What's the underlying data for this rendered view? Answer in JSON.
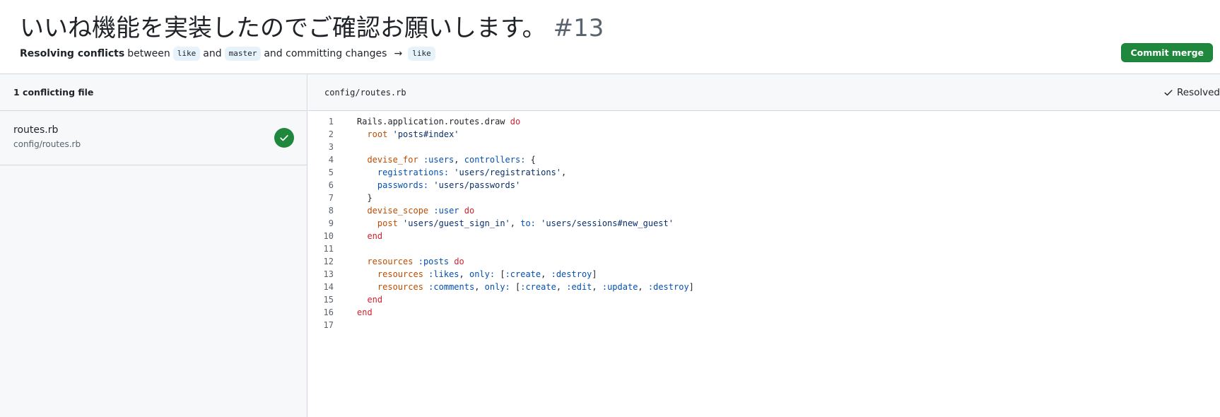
{
  "header": {
    "title": "いいね機能を実装したのでご確認お願いします。",
    "number": "#13",
    "subtitle_strong": "Resolving conflicts",
    "subtitle_between": "between",
    "branch_head": "like",
    "subtitle_and": "and",
    "branch_base": "master",
    "subtitle_committing": "and committing changes",
    "arrow": "→",
    "branch_target": "like",
    "commit_button": "Commit merge"
  },
  "sidebar": {
    "heading": "1 conflicting file",
    "files": [
      {
        "name": "routes.rb",
        "path": "config/routes.rb",
        "status_icon": "check-circle-icon"
      }
    ]
  },
  "editor": {
    "file_path": "config/routes.rb",
    "resolved_label": "Resolved",
    "lines": [
      {
        "n": "1",
        "tokens": [
          [
            "p",
            "Rails.application.routes.draw "
          ],
          [
            "kw",
            "do"
          ]
        ]
      },
      {
        "n": "2",
        "tokens": [
          [
            "p",
            "  "
          ],
          [
            "fn",
            "root"
          ],
          [
            "p",
            " "
          ],
          [
            "str",
            "'posts#index'"
          ]
        ]
      },
      {
        "n": "3",
        "tokens": [
          [
            "p",
            ""
          ]
        ]
      },
      {
        "n": "4",
        "tokens": [
          [
            "p",
            "  "
          ],
          [
            "fn",
            "devise_for"
          ],
          [
            "p",
            " "
          ],
          [
            "sym",
            ":users"
          ],
          [
            "p",
            ", "
          ],
          [
            "sym",
            "controllers:"
          ],
          [
            "p",
            " {"
          ]
        ]
      },
      {
        "n": "5",
        "tokens": [
          [
            "p",
            "    "
          ],
          [
            "sym",
            "registrations:"
          ],
          [
            "p",
            " "
          ],
          [
            "str",
            "'users/registrations'"
          ],
          [
            "p",
            ","
          ]
        ]
      },
      {
        "n": "6",
        "tokens": [
          [
            "p",
            "    "
          ],
          [
            "sym",
            "passwords:"
          ],
          [
            "p",
            " "
          ],
          [
            "str",
            "'users/passwords'"
          ]
        ]
      },
      {
        "n": "7",
        "tokens": [
          [
            "p",
            "  }"
          ]
        ]
      },
      {
        "n": "8",
        "tokens": [
          [
            "p",
            "  "
          ],
          [
            "fn",
            "devise_scope"
          ],
          [
            "p",
            " "
          ],
          [
            "sym",
            ":user"
          ],
          [
            "p",
            " "
          ],
          [
            "kw",
            "do"
          ]
        ]
      },
      {
        "n": "9",
        "tokens": [
          [
            "p",
            "    "
          ],
          [
            "fn",
            "post"
          ],
          [
            "p",
            " "
          ],
          [
            "str",
            "'users/guest_sign_in'"
          ],
          [
            "p",
            ", "
          ],
          [
            "sym",
            "to:"
          ],
          [
            "p",
            " "
          ],
          [
            "str",
            "'users/sessions#new_guest'"
          ]
        ]
      },
      {
        "n": "10",
        "tokens": [
          [
            "p",
            "  "
          ],
          [
            "kw",
            "end"
          ]
        ]
      },
      {
        "n": "11",
        "tokens": [
          [
            "p",
            ""
          ]
        ]
      },
      {
        "n": "12",
        "tokens": [
          [
            "p",
            "  "
          ],
          [
            "fn",
            "resources"
          ],
          [
            "p",
            " "
          ],
          [
            "sym",
            ":posts"
          ],
          [
            "p",
            " "
          ],
          [
            "kw",
            "do"
          ]
        ]
      },
      {
        "n": "13",
        "tokens": [
          [
            "p",
            "    "
          ],
          [
            "fn",
            "resources"
          ],
          [
            "p",
            " "
          ],
          [
            "sym",
            ":likes"
          ],
          [
            "p",
            ", "
          ],
          [
            "sym",
            "only:"
          ],
          [
            "p",
            " ["
          ],
          [
            "sym",
            ":create"
          ],
          [
            "p",
            ", "
          ],
          [
            "sym",
            ":destroy"
          ],
          [
            "p",
            "]"
          ]
        ]
      },
      {
        "n": "14",
        "tokens": [
          [
            "p",
            "    "
          ],
          [
            "fn",
            "resources"
          ],
          [
            "p",
            " "
          ],
          [
            "sym",
            ":comments"
          ],
          [
            "p",
            ", "
          ],
          [
            "sym",
            "only:"
          ],
          [
            "p",
            " ["
          ],
          [
            "sym",
            ":create"
          ],
          [
            "p",
            ", "
          ],
          [
            "sym",
            ":edit"
          ],
          [
            "p",
            ", "
          ],
          [
            "sym",
            ":update"
          ],
          [
            "p",
            ", "
          ],
          [
            "sym",
            ":destroy"
          ],
          [
            "p",
            "]"
          ]
        ]
      },
      {
        "n": "15",
        "tokens": [
          [
            "p",
            "  "
          ],
          [
            "kw",
            "end"
          ]
        ]
      },
      {
        "n": "16",
        "tokens": [
          [
            "kw",
            "end"
          ]
        ]
      },
      {
        "n": "17",
        "tokens": [
          [
            "p",
            ""
          ]
        ]
      }
    ]
  },
  "colors": {
    "accent_green": "#1f883d",
    "keyword": "#cf222e",
    "method": "#bc4c00",
    "symbol": "#0550ae",
    "string": "#0a3069"
  }
}
